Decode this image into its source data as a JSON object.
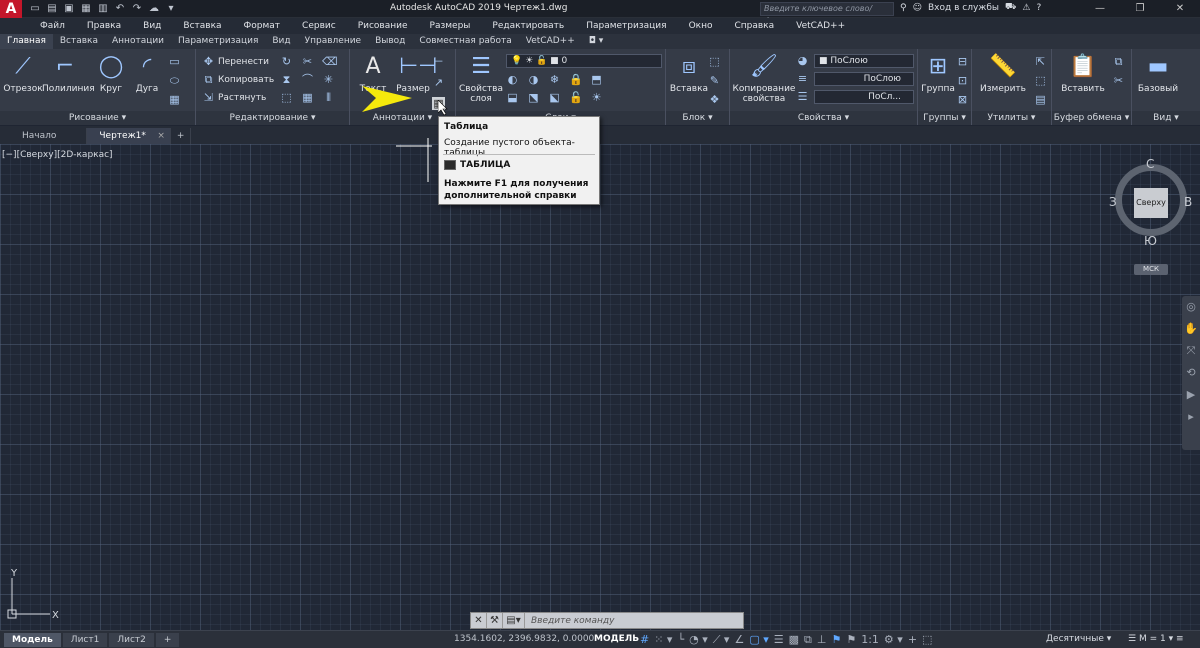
{
  "titlebar": {
    "app_logo": "A",
    "title": "Autodesk AutoCAD 2019    Чертеж1.dwg",
    "search_placeholder": "Введите ключевое слово/фразу",
    "login": "Вход в службы"
  },
  "menubar": [
    "Файл",
    "Правка",
    "Вид",
    "Вставка",
    "Формат",
    "Сервис",
    "Рисование",
    "Размеры",
    "Редактировать",
    "Параметризация",
    "Окно",
    "Справка",
    "VetCAD++"
  ],
  "ribbon_tabs": [
    "Главная",
    "Вставка",
    "Аннотации",
    "Параметризация",
    "Вид",
    "Управление",
    "Вывод",
    "Совместная работа",
    "VetCAD++"
  ],
  "ribbon": {
    "draw": {
      "label": "Рисование",
      "line": "Отрезок",
      "polyline": "Полилиния",
      "circle": "Круг",
      "arc": "Дуга"
    },
    "modify": {
      "label": "Редактирование",
      "move": "Перенести",
      "copy": "Копировать",
      "stretch": "Растянуть"
    },
    "annotation": {
      "label": "Аннотации",
      "text": "Текст",
      "dimension": "Размер"
    },
    "layers": {
      "label": "Слои",
      "layer_props_1": "Свойства",
      "layer_props_2": "слоя",
      "current_layer": "0"
    },
    "block": {
      "label": "Блок",
      "insert": "Вставка"
    },
    "properties": {
      "label": "Свойства",
      "match_1": "Копирование",
      "match_2": "свойства",
      "color": "ПоСлою",
      "linetype": "ПоСлою",
      "lineweight": "ПоСл..."
    },
    "groups": {
      "label": "Группы",
      "group": "Группа"
    },
    "utilities": {
      "label": "Утилиты",
      "measure": "Измерить"
    },
    "clipboard": {
      "label": "Буфер обмена",
      "paste": "Вставить"
    },
    "view": {
      "label": "Вид",
      "base": "Базовый"
    }
  },
  "doc_tabs": [
    "Начало",
    "Чертеж1*"
  ],
  "viewport_label": "[−][Сверху][2D-каркас]",
  "tooltip": {
    "title": "Таблица",
    "description": "Создание пустого объекта-таблицы",
    "command": "ТАБЛИЦА",
    "help": "Нажмите F1 для получения дополнительной справки"
  },
  "viewcube": {
    "north": "С",
    "south": "Ю",
    "west": "З",
    "east": "В",
    "face": "Сверху",
    "wcs": "МСК"
  },
  "ucs": {
    "x": "X",
    "y": "Y"
  },
  "command_line": {
    "placeholder": "Введите команду"
  },
  "status": {
    "layouts": [
      "Модель",
      "Лист1",
      "Лист2"
    ],
    "coords": "1354.1602, 2396.9832, 0.0000",
    "space": "МОДЕЛЬ",
    "scale": "1:1",
    "units": "Десятичные",
    "m": "M = 1"
  },
  "colors": {
    "accent": "#5fa8ff",
    "arrow": "#f5e90c",
    "brand": "#c4162a"
  }
}
